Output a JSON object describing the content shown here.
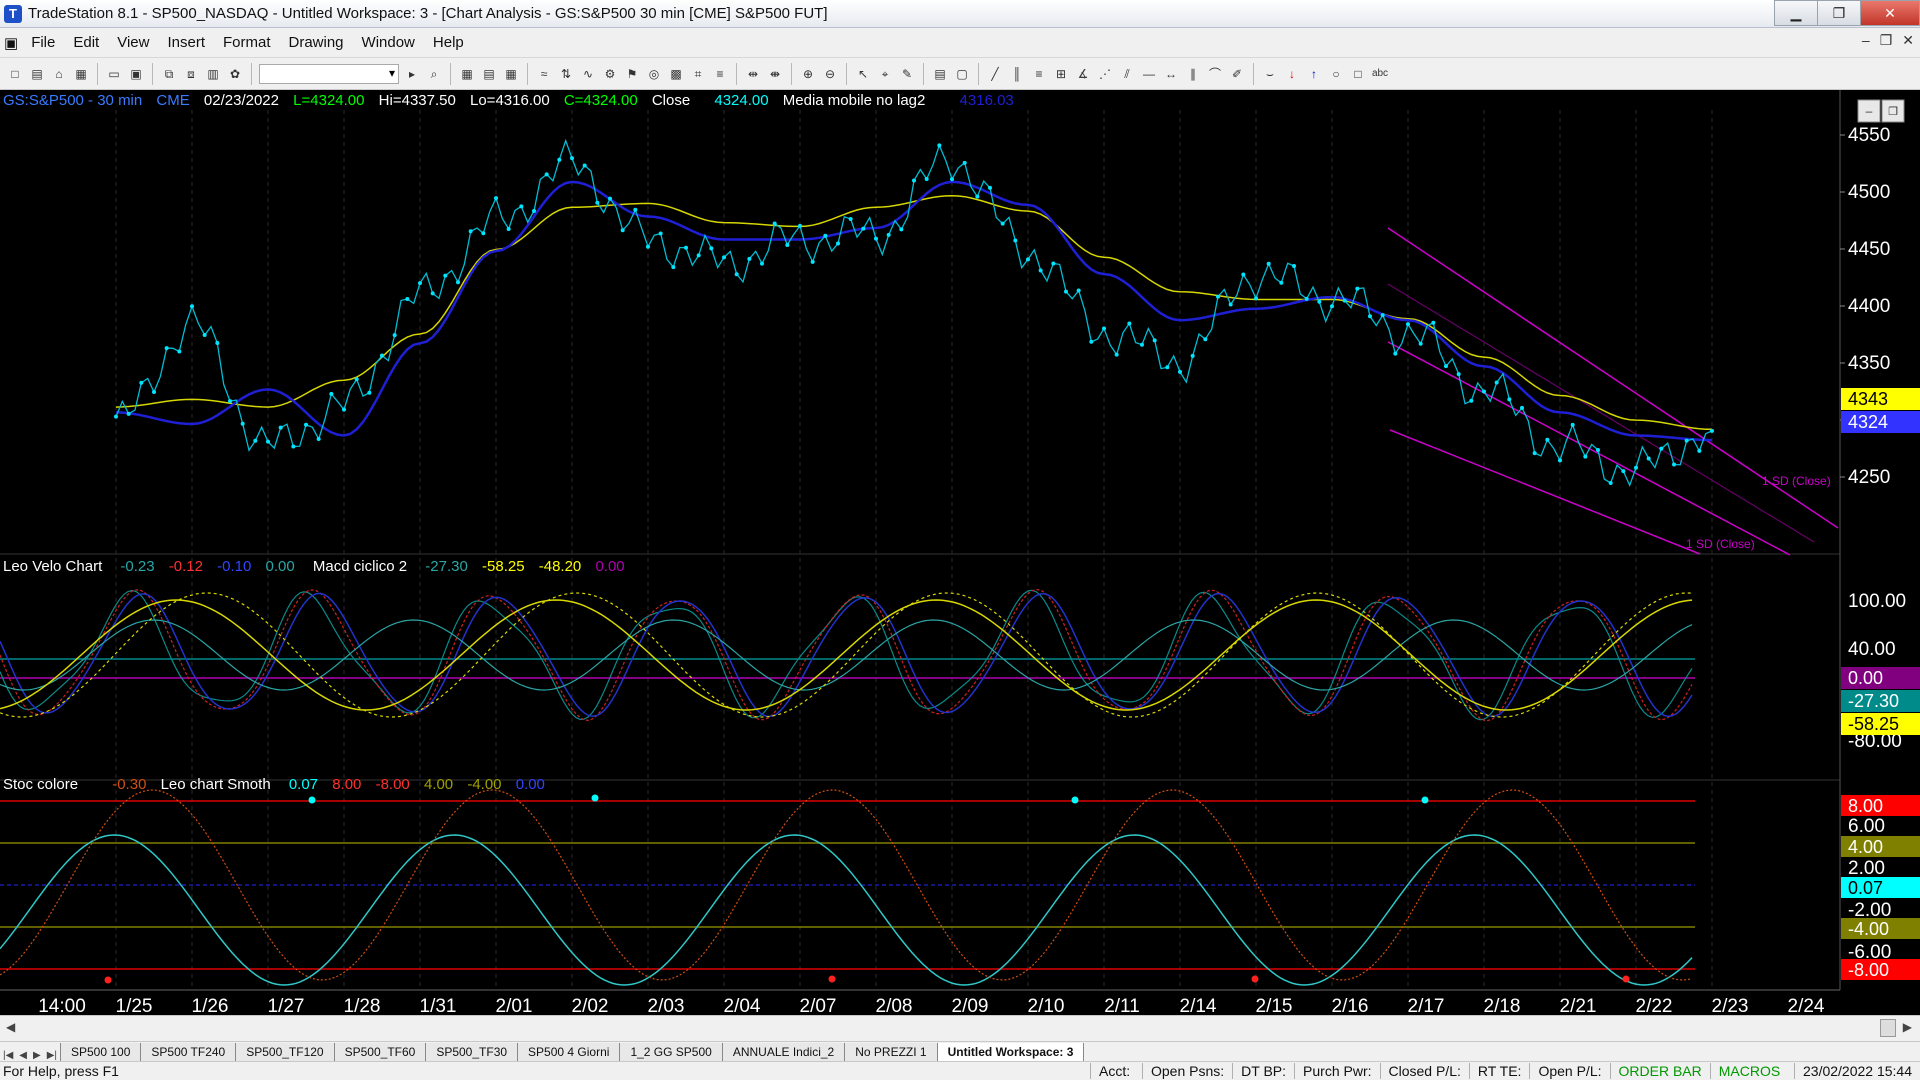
{
  "window": {
    "title": "TradeStation 8.1 - SP500_NASDAQ - Untitled Workspace:  3 - [Chart Analysis - GS:S&P500  30 min  [CME] S&P500 FUT]"
  },
  "menu": [
    "File",
    "Edit",
    "View",
    "Insert",
    "Format",
    "Drawing",
    "Window",
    "Help"
  ],
  "toolbar": {
    "symbol_combo_value": ""
  },
  "chart": {
    "header": {
      "symbol": "GS:S&P500 - 30 min",
      "exchange": "CME",
      "date": "02/23/2022",
      "last": "L=4324.00",
      "hi": "Hi=4337.50",
      "lo": "Lo=4316.00",
      "close_c": "C=4324.00",
      "close_label": "Close",
      "close_value": "4324.00",
      "ma_label": "Media mobile no lag2",
      "ma_value": "4316.03"
    },
    "price_axis": [
      "4550",
      "4500",
      "4450",
      "4400",
      "4350",
      "4300",
      "4250"
    ],
    "price_flags": [
      {
        "value": "4343",
        "bg": "#ffff00",
        "fg": "#000000"
      },
      {
        "value": "4324",
        "bg": "#3333ff",
        "fg": "#ffffff"
      }
    ],
    "channel_labels": [
      "1 SD (Close)",
      "1 SD (Close)"
    ],
    "ind1": {
      "name": "Leo Velo Chart",
      "v1": "-0.23",
      "v2": "-0.12",
      "v3": "-0.10",
      "v4": "0.00",
      "name2": "Macd ciclico 2",
      "v5": "-27.30",
      "v6": "-58.25",
      "v7": "-48.20",
      "v8": "0.00",
      "axis": [
        "100.00",
        "40.00",
        "-80.00"
      ],
      "flags": [
        {
          "value": "0.00",
          "bg": "#800080",
          "fg": "#ffffff"
        },
        {
          "value": "-27.30",
          "bg": "#008b8b",
          "fg": "#ffffff"
        },
        {
          "value": "-58.25",
          "bg": "#ffff00",
          "fg": "#000000"
        }
      ]
    },
    "ind2": {
      "name": "Stoc colore",
      "v1": "-0.30",
      "name2": "Leo chart Smoth",
      "v2": "0.07",
      "v3": "8.00",
      "v4": "-8.00",
      "v5": "4.00",
      "v6": "-4.00",
      "v7": "0.00",
      "axis": [
        "6.00",
        "2.00",
        "-2.00",
        "-6.00"
      ],
      "flags": [
        {
          "value": "8.00",
          "bg": "#ff0000",
          "fg": "#ffffff"
        },
        {
          "value": "4.00",
          "bg": "#808000",
          "fg": "#ffffff"
        },
        {
          "value": "0.07",
          "bg": "#00ffff",
          "fg": "#000000"
        },
        {
          "value": "-4.00",
          "bg": "#808000",
          "fg": "#ffffff"
        },
        {
          "value": "-8.00",
          "bg": "#ff0000",
          "fg": "#ffffff"
        }
      ]
    },
    "time_axis": [
      "14:00",
      "1/25",
      "1/26",
      "1/27",
      "1/28",
      "1/31",
      "2/01",
      "2/02",
      "2/03",
      "2/04",
      "2/07",
      "2/08",
      "2/09",
      "2/10",
      "2/11",
      "2/14",
      "2/15",
      "2/16",
      "2/17",
      "2/18",
      "2/21",
      "2/22",
      "2/23",
      "2/24"
    ]
  },
  "chart_data": {
    "type": "line",
    "title": "GS:S&P500 - 30 min",
    "x": [
      "1/25",
      "1/26",
      "1/27",
      "1/28",
      "1/31",
      "2/01",
      "2/02",
      "2/03",
      "2/04",
      "2/07",
      "2/08",
      "2/09",
      "2/10",
      "2/11",
      "2/14",
      "2/15",
      "2/16",
      "2/17",
      "2/18",
      "2/21",
      "2/22",
      "2/23"
    ],
    "series": [
      {
        "name": "Close",
        "values": [
          4330,
          4415,
          4310,
          4345,
          4440,
          4505,
          4555,
          4490,
          4470,
          4490,
          4495,
          4560,
          4480,
          4410,
          4385,
          4460,
          4440,
          4410,
          4360,
          4310,
          4290,
          4324
        ]
      },
      {
        "name": "Media mobile no lag2",
        "values": [
          4340,
          4330,
          4360,
          4320,
          4400,
          4480,
          4540,
          4510,
          4490,
          4490,
          4500,
          4540,
          4520,
          4460,
          4420,
          4430,
          4440,
          4420,
          4380,
          4340,
          4320,
          4316
        ]
      }
    ],
    "ylim": [
      4225,
      4585
    ]
  },
  "tabs": [
    "SP500 100",
    "SP500 TF240",
    "SP500_TF120",
    "SP500_TF60",
    "SP500_TF30",
    "SP500 4 Giorni",
    "1_2 GG SP500",
    "ANNUALE Indici_2",
    "No PREZZI 1",
    "Untitled Workspace:  3"
  ],
  "status": {
    "help": "For Help, press F1",
    "acct": "Acct:",
    "open_psns": "Open Psns:",
    "dt_bp": "DT BP:",
    "purch_pwr": "Purch Pwr:",
    "closed_pl": "Closed P/L:",
    "rt_te": "RT TE:",
    "open_pl": "Open P/L:",
    "order_bar": "ORDER BAR",
    "macros": "MACROS",
    "datetime": "23/02/2022 15:44"
  }
}
